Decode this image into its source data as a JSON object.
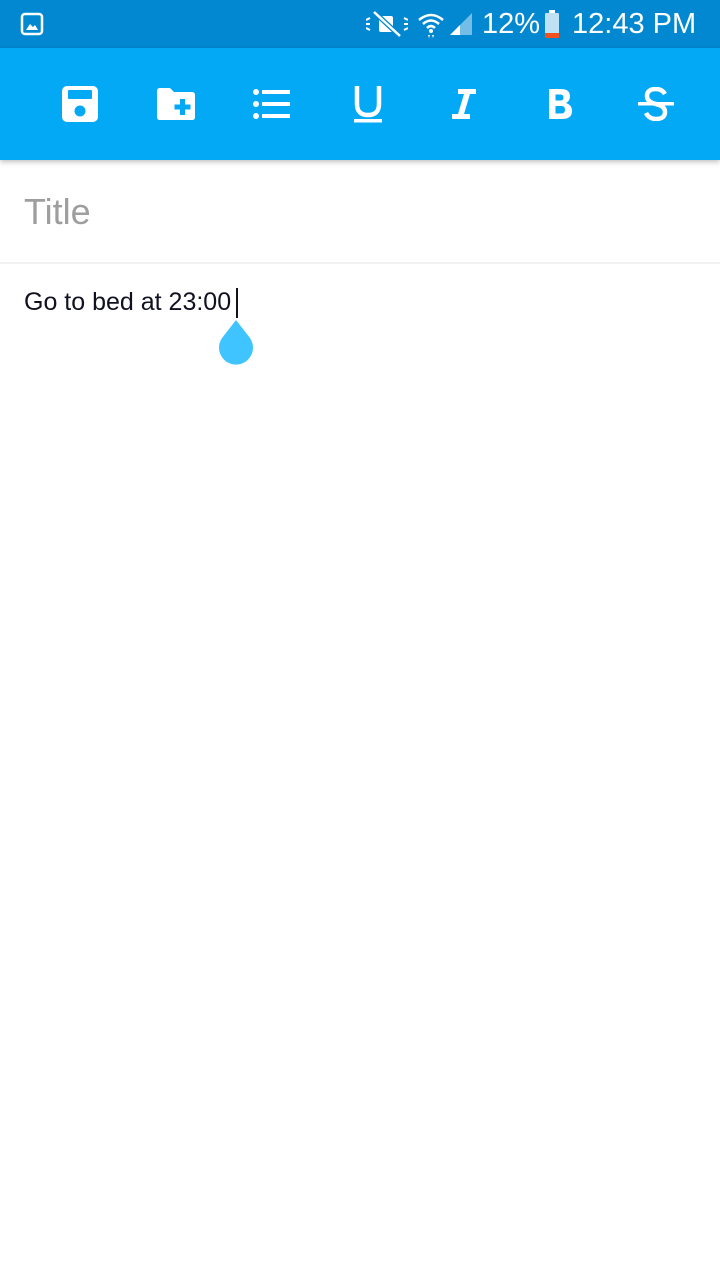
{
  "status_bar": {
    "battery_percent": "12%",
    "time": "12:43 PM",
    "icons": [
      "gallery-icon",
      "mute-icon",
      "wifi-icon",
      "signal-icon",
      "battery-icon"
    ],
    "color": "#0288d1"
  },
  "toolbar": {
    "color": "#03a9f4",
    "buttons": [
      {
        "name": "save-icon"
      },
      {
        "name": "add-folder-icon"
      },
      {
        "name": "list-icon"
      },
      {
        "name": "underline-icon",
        "glyph": "U"
      },
      {
        "name": "italic-icon",
        "glyph": "I"
      },
      {
        "name": "bold-icon",
        "glyph": "B"
      },
      {
        "name": "strikethrough-icon",
        "glyph": "S"
      }
    ]
  },
  "editor": {
    "title_placeholder": "Title",
    "title_value": "",
    "body_text": "Go to bed at 23:00",
    "accent_color": "#40c4ff"
  }
}
